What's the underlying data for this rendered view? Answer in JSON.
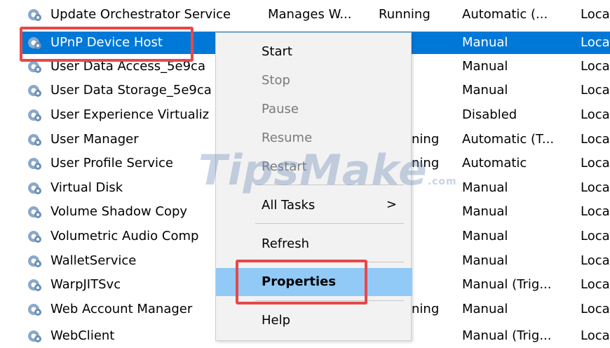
{
  "services": [
    {
      "name": "Update Orchestrator Service",
      "description": "Manages W...",
      "status": "Running",
      "startup": "Automatic (...",
      "logon": "Loca"
    },
    {
      "name": "UPnP Device Host",
      "description": "",
      "status": "",
      "startup": "Manual",
      "logon": "Loca"
    },
    {
      "name": "User Data Access_5e9ca",
      "description": "",
      "status": "",
      "startup": "Manual",
      "logon": "Loca"
    },
    {
      "name": "User Data Storage_5e9ca",
      "description": "",
      "status": "",
      "startup": "Manual",
      "logon": "Loca"
    },
    {
      "name": "User Experience Virtualiz",
      "description": "",
      "status": "",
      "startup": "Disabled",
      "logon": "Loca"
    },
    {
      "name": "User Manager",
      "description": "",
      "status": "ning",
      "startup": "Automatic (T...",
      "logon": "Loca"
    },
    {
      "name": "User Profile Service",
      "description": "",
      "status": "ning",
      "startup": "Automatic",
      "logon": "Loca"
    },
    {
      "name": "Virtual Disk",
      "description": "",
      "status": "",
      "startup": "Manual",
      "logon": "Loca"
    },
    {
      "name": "Volume Shadow Copy",
      "description": "",
      "status": "",
      "startup": "Manual",
      "logon": "Loca"
    },
    {
      "name": "Volumetric Audio Comp",
      "description": "",
      "status": "",
      "startup": "Manual",
      "logon": "Loca"
    },
    {
      "name": "WalletService",
      "description": "",
      "status": "",
      "startup": "Manual",
      "logon": "Loca"
    },
    {
      "name": "WarpJITSvc",
      "description": "",
      "status": "",
      "startup": "Manual (Trig...",
      "logon": "Loca"
    },
    {
      "name": "Web Account Manager",
      "description": "",
      "status": "ning",
      "startup": "Manual",
      "logon": "Loca"
    },
    {
      "name": "WebClient",
      "description": "",
      "status": "",
      "startup": "Manual (Trig...",
      "logon": "Loca"
    }
  ],
  "context_menu": {
    "start": "Start",
    "stop": "Stop",
    "pause": "Pause",
    "resume": "Resume",
    "restart": "Restart",
    "all_tasks": "All Tasks",
    "all_tasks_arrow": ">",
    "refresh": "Refresh",
    "properties": "Properties",
    "help": "Help"
  },
  "watermark": {
    "text": "TipsMake",
    "suffix": ".com"
  },
  "colors": {
    "selection": "#0078d7",
    "menu_hover": "#91c9f7",
    "highlight_box": "#e8484a"
  },
  "icons": {
    "service": "gear-service-icon"
  }
}
